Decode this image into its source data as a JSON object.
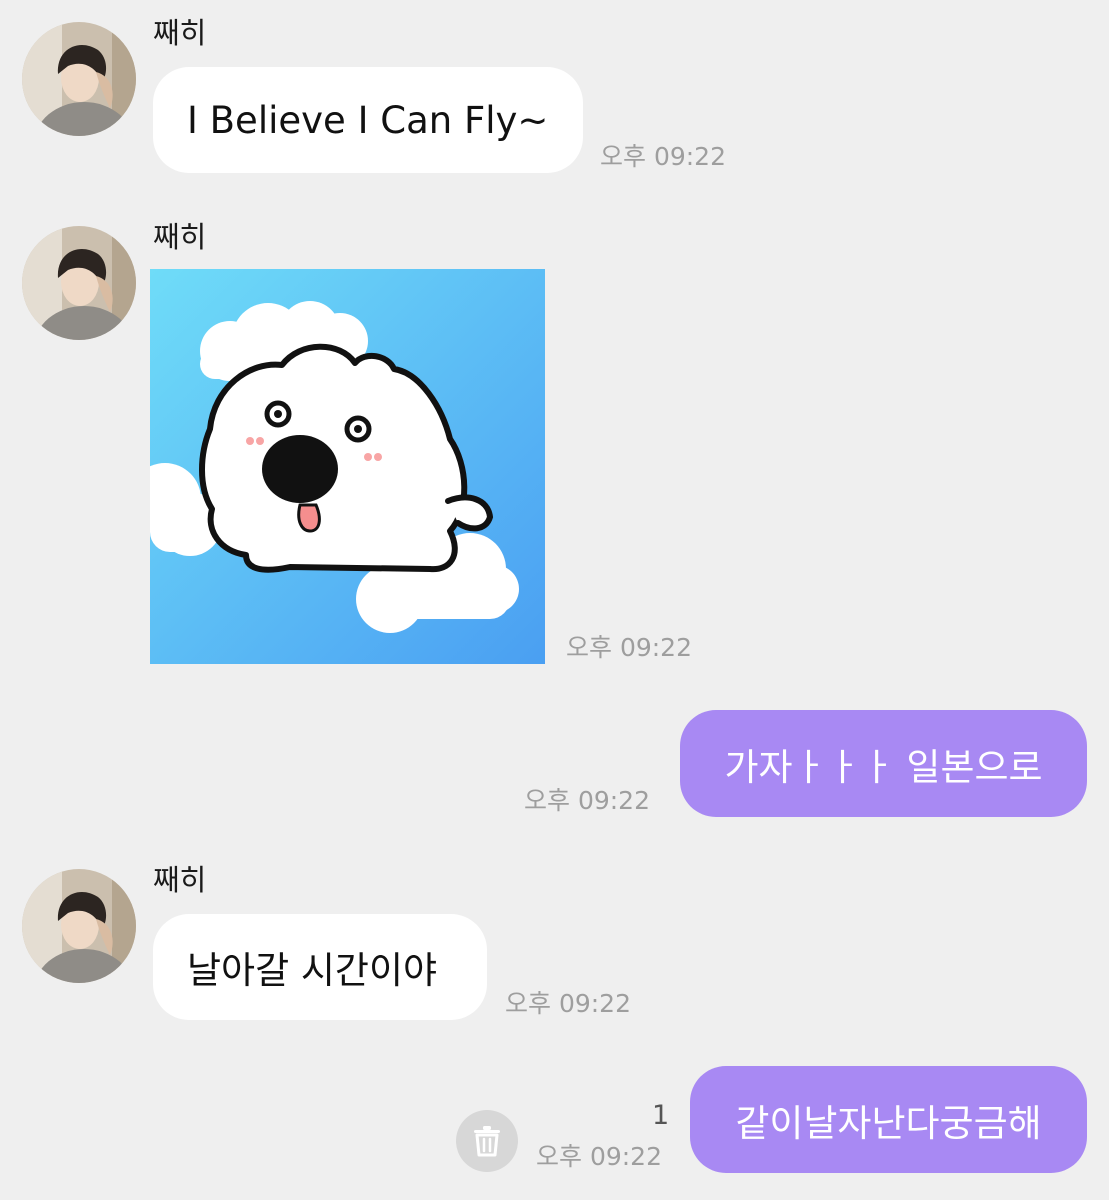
{
  "messages": [
    {
      "sender": "째히",
      "text": "I Believe I Can Fly~",
      "time": "오후 09:22"
    },
    {
      "sender": "째히",
      "kind": "sticker",
      "sticker_icon": "flying-white-dog-on-clouds",
      "time": "오후 09:22"
    },
    {
      "kind": "outgoing",
      "text": "가자ㅏㅏㅏ 일본으로",
      "time": "오후 09:22"
    },
    {
      "sender": "째히",
      "text": "날아갈 시간이야",
      "time": "오후 09:22"
    },
    {
      "kind": "outgoing",
      "text": "같이날자난다궁금해",
      "time": "오후 09:22",
      "unread_count": "1",
      "action_icon": "trash-icon"
    }
  ],
  "colors": {
    "background": "#efefef",
    "incoming_bubble": "#ffffff",
    "outgoing_bubble": "#a889f3",
    "timestamp": "#9e9e9e",
    "sticker_sky": "#5fb4f8"
  }
}
